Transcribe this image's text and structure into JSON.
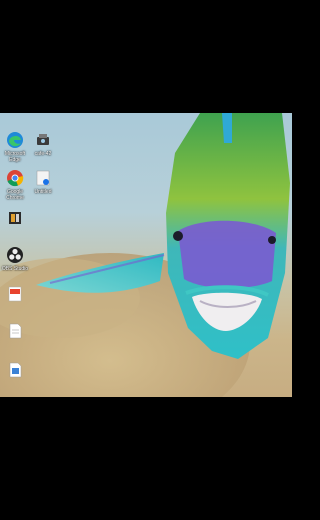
{
  "desktop": {
    "icons": [
      {
        "label": "Microsoft Edge",
        "icon": "edge-icon"
      },
      {
        "label": "cafe-42",
        "icon": "app-icon"
      },
      {
        "label": "Google Chrome",
        "icon": "chrome-icon"
      },
      {
        "label": "Untitled",
        "icon": "document-icon"
      },
      {
        "label": "",
        "icon": "shortcut-icon"
      },
      {
        "label": "OBS Studio",
        "icon": "obs-icon"
      },
      {
        "label": "",
        "icon": "pdf-icon"
      },
      {
        "label": "",
        "icon": "file-icon"
      },
      {
        "label": "",
        "icon": "file-icon"
      }
    ]
  },
  "colors": {
    "letterbox": "#000000",
    "water_top": "#a9c9d8",
    "sand": "#c7ad82",
    "fish_green": "#6fb04a",
    "fish_teal": "#2fc0c8",
    "fish_purple": "#7a5bd0"
  }
}
